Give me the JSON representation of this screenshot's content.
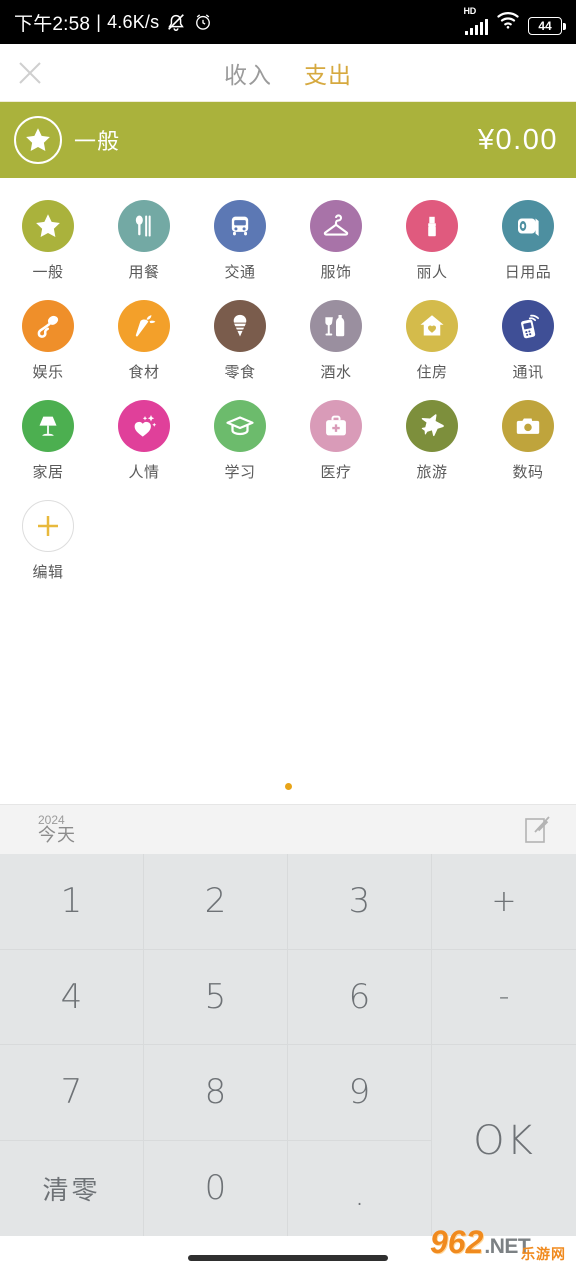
{
  "statusbar": {
    "time": "下午2:58",
    "separator": "|",
    "network_speed": "4.6K/s",
    "mute_icon": "mute-icon",
    "alarm_icon": "alarm-icon",
    "network_type": "HD",
    "battery_level": "44"
  },
  "header": {
    "close_icon": "close-icon",
    "tabs": [
      {
        "label": "收入",
        "active": false
      },
      {
        "label": "支出",
        "active": true
      }
    ],
    "active_color": "#d6a93f",
    "inactive_color": "#9b9b9b"
  },
  "banner": {
    "icon": "star-icon",
    "label": "一般",
    "amount": "¥0.00",
    "background": "#aab23c"
  },
  "categories": [
    {
      "label": "一般",
      "icon": "star-icon",
      "color": "#aab23c"
    },
    {
      "label": "用餐",
      "icon": "cutlery-icon",
      "color": "#73a9a4"
    },
    {
      "label": "交通",
      "icon": "bus-icon",
      "color": "#5c78b4"
    },
    {
      "label": "服饰",
      "icon": "hanger-icon",
      "color": "#a873a8"
    },
    {
      "label": "丽人",
      "icon": "lipstick-icon",
      "color": "#e05a7e"
    },
    {
      "label": "日用品",
      "icon": "tissue-roll-icon",
      "color": "#4d8fa0"
    },
    {
      "label": "娱乐",
      "icon": "microphone-icon",
      "color": "#ef8f2a"
    },
    {
      "label": "食材",
      "icon": "carrot-icon",
      "color": "#f3a02a"
    },
    {
      "label": "零食",
      "icon": "icecream-icon",
      "color": "#7a5c4c"
    },
    {
      "label": "酒水",
      "icon": "wine-icon",
      "color": "#9a8f9f"
    },
    {
      "label": "住房",
      "icon": "house-heart-icon",
      "color": "#d4bb4b"
    },
    {
      "label": "通讯",
      "icon": "cellphone-icon",
      "color": "#3f4f96"
    },
    {
      "label": "家居",
      "icon": "lamp-icon",
      "color": "#4caf50"
    },
    {
      "label": "人情",
      "icon": "heart-sparkle-icon",
      "color": "#e0409a"
    },
    {
      "label": "学习",
      "icon": "graduation-icon",
      "color": "#6cbb6c"
    },
    {
      "label": "医疗",
      "icon": "firstaid-icon",
      "color": "#d99bb8"
    },
    {
      "label": "旅游",
      "icon": "airplane-icon",
      "color": "#7d8f3c"
    },
    {
      "label": "数码",
      "icon": "camera-icon",
      "color": "#bfa43c"
    },
    {
      "label": "编辑",
      "icon": "plus-icon",
      "color": "#e8b93c",
      "outline": true
    }
  ],
  "pager": {
    "dot_count": 1,
    "active_index": 0,
    "active_color": "#e8a418"
  },
  "datebar": {
    "year": "2024",
    "day": "今天",
    "note_icon": "note-edit-icon"
  },
  "keypad": {
    "keys": [
      {
        "label": "1",
        "type": "num"
      },
      {
        "label": "2",
        "type": "num"
      },
      {
        "label": "3",
        "type": "num"
      },
      {
        "label": "+",
        "type": "op"
      },
      {
        "label": "4",
        "type": "num"
      },
      {
        "label": "5",
        "type": "num"
      },
      {
        "label": "6",
        "type": "num"
      },
      {
        "label": "-",
        "type": "op"
      },
      {
        "label": "7",
        "type": "num"
      },
      {
        "label": "8",
        "type": "num"
      },
      {
        "label": "9",
        "type": "num"
      },
      {
        "label": "OK",
        "type": "ok"
      },
      {
        "label": "清零",
        "type": "cn"
      },
      {
        "label": "0",
        "type": "num"
      },
      {
        "label": ".",
        "type": "dot"
      }
    ]
  },
  "watermark": {
    "brand": "962",
    "tld": ".NET",
    "subtitle": "乐游网"
  }
}
